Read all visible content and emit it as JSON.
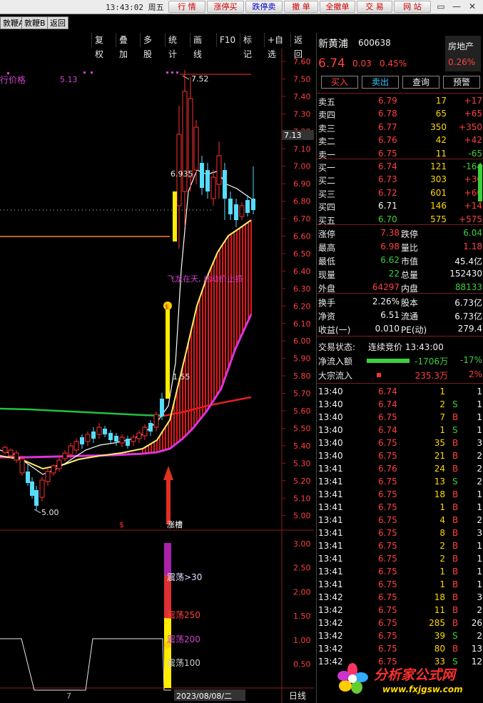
{
  "topbar": {
    "time": "13:43:02 周五",
    "nav": [
      "行 情",
      "涨停买",
      "跌停卖",
      "撤 单",
      "全撤单",
      "交 易",
      "网 站"
    ],
    "window_controls": [
      "▭",
      "—",
      "✕"
    ]
  },
  "tabs": [
    "敦鞭A",
    "敦鞭B",
    "返回"
  ],
  "toolbar": [
    "复权",
    "叠加",
    "多股",
    "统计",
    "画线",
    "F10",
    "标记",
    "+自选",
    "返回"
  ],
  "chart": {
    "price_axis": [
      "7.60",
      "7.50",
      "7.40",
      "7.30",
      "7.20",
      "7.10",
      "7.00",
      "6.90",
      "6.80",
      "6.70",
      "6.60",
      "6.50",
      "6.40",
      "6.30",
      "6.20",
      "6.10",
      "6.00",
      "5.90",
      "5.80",
      "5.70",
      "5.60",
      "5.50",
      "5.40",
      "5.30",
      "5.20",
      "5.10",
      "5.00"
    ],
    "current_price_tag": "7.13",
    "label_price": "行价格",
    "label_513": "5.13",
    "high_label": "7.52",
    "label_6935": "6.935",
    "label_555": "1.55",
    "low_label": "5.00",
    "signal_text": "飞龙在天, 启动价止损",
    "mark_s": "$",
    "mark_fire": "涨槽",
    "lower_axis": [
      "3.00",
      "2.50",
      "2.00",
      "1.50",
      "1.00",
      "0.50"
    ],
    "lower_labels": [
      "震荡>30",
      "震荡250",
      "震荡200",
      "震荡100"
    ],
    "x_left": "7",
    "date": "2023/08/08/二",
    "period": "日线"
  },
  "quote": {
    "name": "新黄浦",
    "code": "600638",
    "sector": "房地产",
    "sector_change": "0.26%",
    "price": "6.74",
    "change": "0.03",
    "pct": "0.45%",
    "buttons": [
      "买入",
      "卖出",
      "查询",
      "预警"
    ],
    "asks": [
      {
        "label": "卖五",
        "price": "6.79",
        "vol": "17",
        "chg": "+17"
      },
      {
        "label": "卖四",
        "price": "6.78",
        "vol": "65",
        "chg": "+65"
      },
      {
        "label": "卖三",
        "price": "6.77",
        "vol": "350",
        "chg": "+350"
      },
      {
        "label": "卖二",
        "price": "6.76",
        "vol": "42",
        "chg": "+42"
      },
      {
        "label": "卖一",
        "price": "6.75",
        "vol": "11",
        "chg": "-65"
      }
    ],
    "bids": [
      {
        "label": "买一",
        "price": "6.74",
        "vol": "121",
        "chg": "-164"
      },
      {
        "label": "买二",
        "price": "6.73",
        "vol": "303",
        "chg": "+30"
      },
      {
        "label": "买三",
        "price": "6.72",
        "vol": "601",
        "chg": "+60"
      },
      {
        "label": "买四",
        "price": "6.71",
        "vol": "146",
        "chg": "+14"
      },
      {
        "label": "买五",
        "price": "6.70",
        "vol": "575",
        "chg": "+575"
      }
    ],
    "stats": [
      {
        "l1": "涨停",
        "v1": "7.38",
        "l2": "跌停",
        "v2": "6.04"
      },
      {
        "l1": "最高",
        "v1": "6.98",
        "l2": "量比",
        "v2": "1.18"
      },
      {
        "l1": "最低",
        "v1": "6.62",
        "l2": "市值",
        "v2": "45.4亿"
      },
      {
        "l1": "现量",
        "v1": "22",
        "l2": "总量",
        "v2": "152430"
      },
      {
        "l1": "外盘",
        "v1": "64297",
        "l2": "内盘",
        "v2": "88133"
      }
    ],
    "fund": [
      {
        "l1": "换手",
        "v1": "2.26%",
        "l2": "股本",
        "v2": "6.73亿"
      },
      {
        "l1": "净资",
        "v1": "6.51",
        "l2": "流通",
        "v2": "6.73亿"
      },
      {
        "l1": "收益(一)",
        "v1": "0.010",
        "l2": "PE(动)",
        "v2": "279.4"
      }
    ],
    "trade_state_label": "交易状态:",
    "trade_state": "连续竞价 13:43:00",
    "net_inflow_label": "净流入额",
    "net_inflow": "-1706万",
    "net_inflow_pct": "-17%",
    "block_inflow_label": "大宗流入",
    "block_inflow": "235.3万",
    "block_inflow_pct": "2%"
  },
  "ticks": [
    {
      "t": "13:40",
      "p": "6.74",
      "v": "1",
      "s": "",
      "n": "1"
    },
    {
      "t": "13:40",
      "p": "6.74",
      "v": "2",
      "s": "S",
      "n": "1"
    },
    {
      "t": "13:40",
      "p": "6.75",
      "v": "7",
      "s": "B",
      "n": "1"
    },
    {
      "t": "13:40",
      "p": "6.74",
      "v": "1",
      "s": "S",
      "n": "1"
    },
    {
      "t": "13:40",
      "p": "6.75",
      "v": "35",
      "s": "B",
      "n": "3"
    },
    {
      "t": "13:40",
      "p": "6.75",
      "v": "21",
      "s": "B",
      "n": "2"
    },
    {
      "t": "13:41",
      "p": "6.76",
      "v": "24",
      "s": "B",
      "n": "2"
    },
    {
      "t": "13:41",
      "p": "6.75",
      "v": "13",
      "s": "S",
      "n": "2"
    },
    {
      "t": "13:41",
      "p": "6.75",
      "v": "18",
      "s": "B",
      "n": "1"
    },
    {
      "t": "13:41",
      "p": "6.75",
      "v": "1",
      "s": "B",
      "n": "1"
    },
    {
      "t": "13:41",
      "p": "6.75",
      "v": "4",
      "s": "B",
      "n": "2"
    },
    {
      "t": "13:41",
      "p": "6.75",
      "v": "8",
      "s": "B",
      "n": "3"
    },
    {
      "t": "13:41",
      "p": "6.75",
      "v": "2",
      "s": "B",
      "n": "1"
    },
    {
      "t": "13:41",
      "p": "6.75",
      "v": "2",
      "s": "B",
      "n": "1"
    },
    {
      "t": "13:41",
      "p": "6.75",
      "v": "1",
      "s": "B",
      "n": "1"
    },
    {
      "t": "13:41",
      "p": "6.75",
      "v": "1",
      "s": "B",
      "n": "1"
    },
    {
      "t": "13:42",
      "p": "6.75",
      "v": "18",
      "s": "B",
      "n": "3"
    },
    {
      "t": "13:42",
      "p": "6.75",
      "v": "11",
      "s": "B",
      "n": "2"
    },
    {
      "t": "13:42",
      "p": "6.75",
      "v": "285",
      "s": "B",
      "n": "26"
    },
    {
      "t": "13:42",
      "p": "6.75",
      "v": "39",
      "s": "S",
      "n": "2"
    },
    {
      "t": "13:42",
      "p": "6.75",
      "v": "80",
      "s": "B",
      "n": "13"
    },
    {
      "t": "13:42",
      "p": "6.75",
      "v": "33",
      "s": "S",
      "n": "12"
    }
  ],
  "watermark": {
    "text": "分析家公式网",
    "url": "www.fxjgsw.com"
  }
}
